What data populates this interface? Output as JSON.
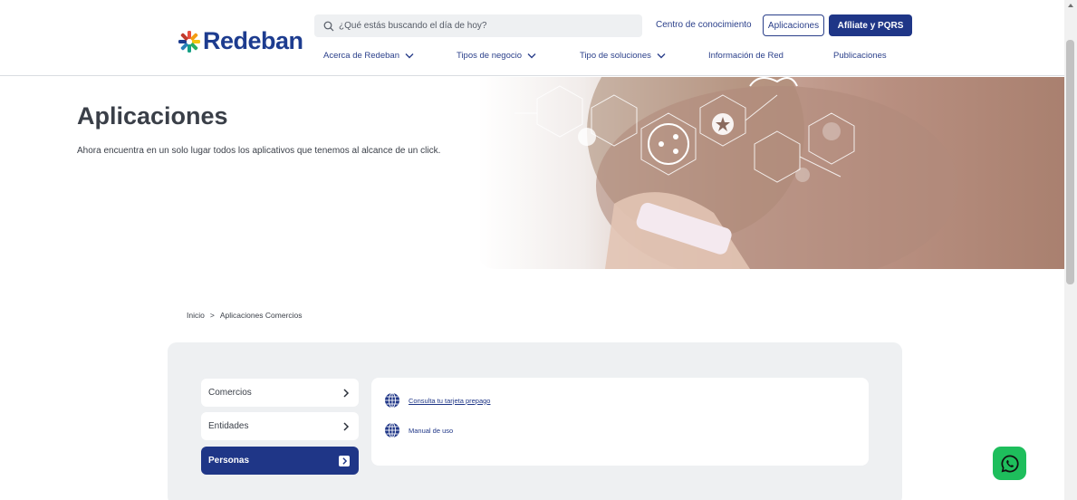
{
  "header": {
    "logo_text": "Redeban",
    "search_placeholder": "¿Qué estás buscando el día de hoy?",
    "centro_label": "Centro de conocimiento",
    "aplicaciones_label": "Aplicaciones",
    "afiliate_label": "Afíliate y PQRS",
    "nav": [
      {
        "label": "Acerca de Redeban"
      },
      {
        "label": "Tipos de negocio"
      },
      {
        "label": "Tipo de soluciones"
      },
      {
        "label": "Información de Red"
      },
      {
        "label": "Publicaciones"
      }
    ]
  },
  "hero": {
    "title": "Aplicaciones",
    "description": "Ahora encuentra en un solo lugar todos los aplicativos que tenemos al alcance de un click."
  },
  "breadcrumb": {
    "home": "Inicio",
    "separator": ">",
    "current": "Aplicaciones Comercios"
  },
  "tabs": [
    {
      "label": "Comercios",
      "active": false
    },
    {
      "label": "Entidades",
      "active": false
    },
    {
      "label": "Personas",
      "active": true
    }
  ],
  "links": [
    {
      "label": "Consulta tu tarjeta prepago"
    },
    {
      "label": "Manual de uso"
    }
  ],
  "colors": {
    "primary": "#1f3687",
    "whatsapp": "#1ebe5c",
    "panel_bg": "#eef0f2"
  },
  "icons": {
    "search": "search-icon",
    "chevron": "chevron-down-icon",
    "arrow": "chevron-right-icon",
    "globe": "globe-icon",
    "whatsapp": "whatsapp-icon"
  }
}
